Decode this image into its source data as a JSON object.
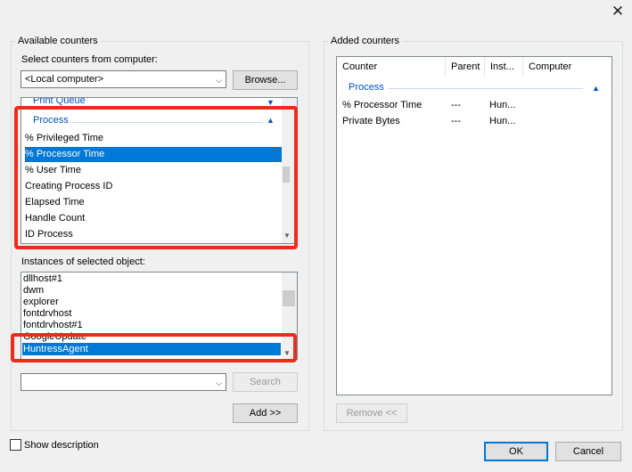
{
  "window": {
    "close_glyph": "✕"
  },
  "available": {
    "group_title": "Available counters",
    "computer_label": "Select counters from computer:",
    "computer_value": "<Local computer>",
    "browse_label": "Browse...",
    "categories": [
      {
        "label": "Print Queue"
      },
      {
        "label": "Process"
      }
    ],
    "counters": [
      {
        "label": "% Privileged Time",
        "selected": false
      },
      {
        "label": "% Processor Time",
        "selected": true
      },
      {
        "label": "% User Time",
        "selected": false
      },
      {
        "label": "Creating Process ID",
        "selected": false
      },
      {
        "label": "Elapsed Time",
        "selected": false
      },
      {
        "label": "Handle Count",
        "selected": false
      },
      {
        "label": "ID Process",
        "selected": false
      }
    ],
    "instances_label": "Instances of selected object:",
    "instances": [
      {
        "label": "dllhost#1",
        "selected": false
      },
      {
        "label": "dwm",
        "selected": false
      },
      {
        "label": "explorer",
        "selected": false
      },
      {
        "label": "fontdrvhost",
        "selected": false
      },
      {
        "label": "fontdrvhost#1",
        "selected": false
      },
      {
        "label": "GoogleUpdate",
        "selected": false
      },
      {
        "label": "HuntressAgent",
        "selected": true
      }
    ],
    "search_value": "",
    "search_label": "Search",
    "add_label": "Add >>"
  },
  "added": {
    "group_title": "Added counters",
    "columns": [
      "Counter",
      "Parent",
      "Inst...",
      "Computer"
    ],
    "category": "Process",
    "rows": [
      {
        "counter": "% Processor Time",
        "parent": "---",
        "inst": "Hun...",
        "computer": ""
      },
      {
        "counter": "Private Bytes",
        "parent": "---",
        "inst": "Hun...",
        "computer": ""
      }
    ],
    "remove_label": "Remove <<"
  },
  "footer": {
    "show_description_label": "Show description",
    "show_description_checked": false,
    "ok_label": "OK",
    "cancel_label": "Cancel"
  },
  "icons": {
    "close": "close-icon",
    "dropdown": "chevron-down-icon",
    "collapse": "chevron-up-icon"
  },
  "colors": {
    "selection": "#0078d7",
    "category_text": "#0050c8",
    "highlight_box": "#ee2a1b"
  }
}
